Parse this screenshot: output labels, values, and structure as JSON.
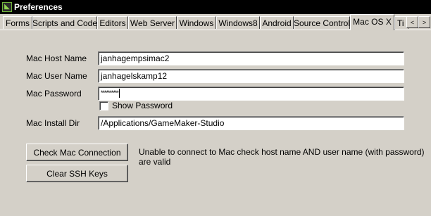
{
  "window": {
    "title": "Preferences",
    "icon": "gamemaker-logo-icon"
  },
  "tabs": [
    {
      "label": "Forms"
    },
    {
      "label": "Scripts and Code"
    },
    {
      "label": "Editors"
    },
    {
      "label": "Web Server"
    },
    {
      "label": "Windows"
    },
    {
      "label": "Windows8"
    },
    {
      "label": "Android"
    },
    {
      "label": "Source Control"
    },
    {
      "label": "Mac OS X",
      "active": true
    },
    {
      "label": "Ti"
    }
  ],
  "tab_scroll": {
    "left_icon": "arrow-left-icon",
    "right_icon": "arrow-right-icon",
    "left_glyph": "<",
    "right_glyph": ">"
  },
  "form": {
    "host_label": "Mac Host Name",
    "host_value": "janhagempsimac2",
    "user_label": "Mac User Name",
    "user_value": "janhagelskamp12",
    "password_label": "Mac Password",
    "password_value": "**********",
    "show_password_label": "Show Password",
    "show_password_checked": false,
    "install_dir_label": "Mac Install Dir",
    "install_dir_value": "/Applications/GameMaker-Studio"
  },
  "actions": {
    "check_connection_label": "Check Mac Connection",
    "clear_ssh_label": "Clear SSH Keys",
    "status_line1": "Unable to connect to Mac check host name AND user name (with password)",
    "status_line2": "are valid"
  }
}
